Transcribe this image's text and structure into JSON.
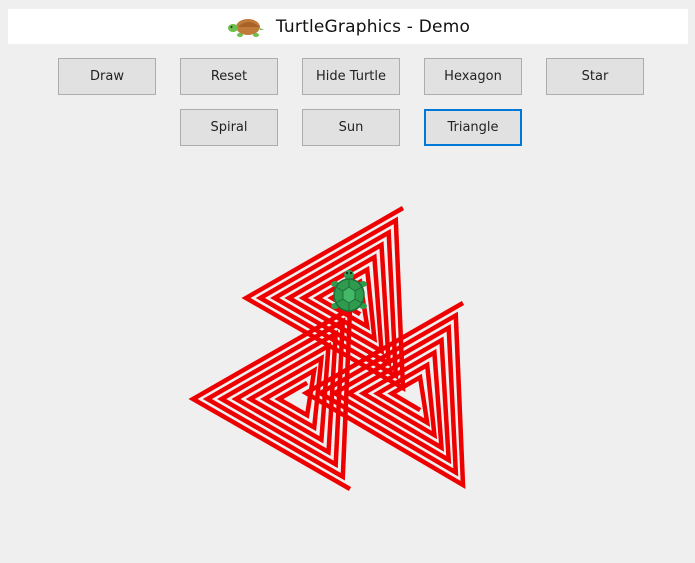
{
  "window": {
    "title": "TurtleGraphics - Demo",
    "logo_icon": "turtle-icon"
  },
  "toolbar": {
    "row1": [
      "Draw",
      "Reset",
      "Hide Turtle",
      "Hexagon",
      "Star"
    ],
    "row2": [
      "Spiral",
      "Sun",
      "Triangle"
    ],
    "focused_button": "Triangle"
  },
  "canvas": {
    "drawing": "triangle-spirals",
    "stroke_color": "#ee0000",
    "turtle_icon": "turtle-icon",
    "turtle_shell_color": "#2e9b4f"
  }
}
